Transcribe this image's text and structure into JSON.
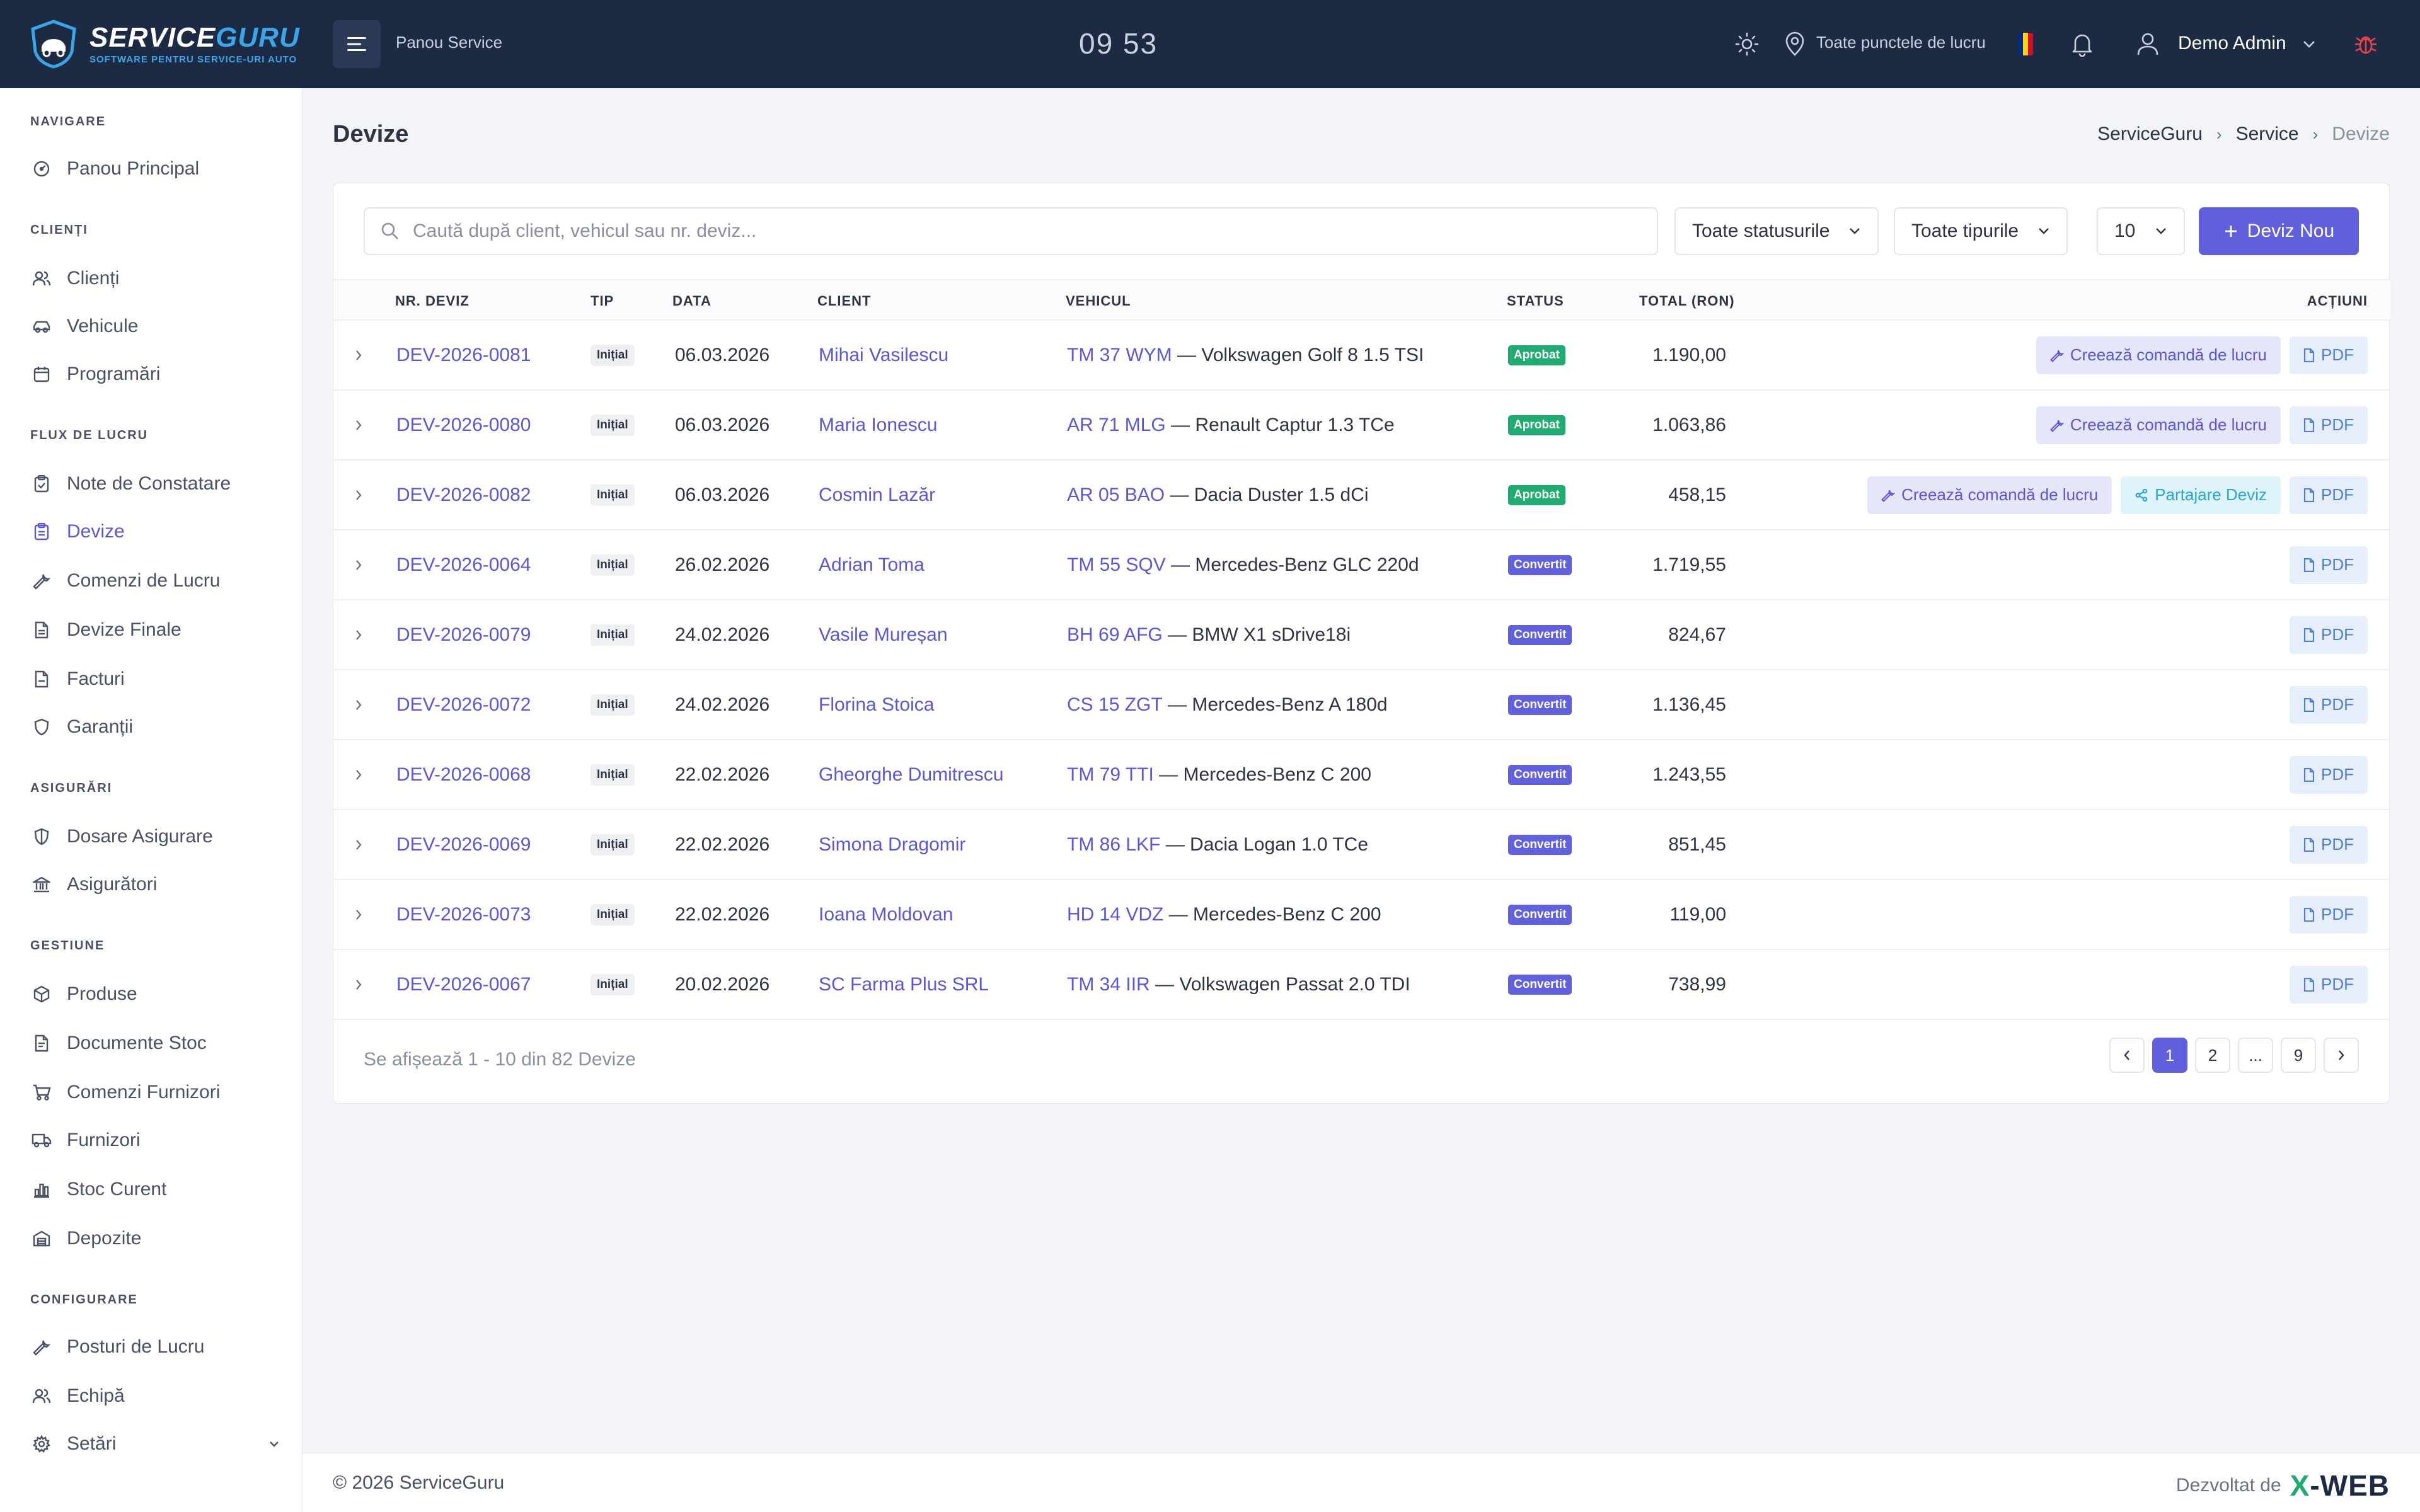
{
  "brand": {
    "title_main": "SERVICE",
    "title_accent": "GURU",
    "subtitle": "SOFTWARE PENTRU SERVICE-URI AUTO"
  },
  "header": {
    "panel_label": "Panou Service",
    "clock": "09 53",
    "location": "Toate punctele de lucru",
    "user": "Demo Admin",
    "flag_colors": [
      "#002b7f",
      "#fcd116",
      "#ce1126"
    ]
  },
  "sidebar": {
    "sections": [
      {
        "title": "NAVIGARE",
        "items": [
          {
            "label": "Panou Principal",
            "icon": "dashboard-icon"
          }
        ]
      },
      {
        "title": "CLIENȚI",
        "items": [
          {
            "label": "Clienți",
            "icon": "users-icon"
          },
          {
            "label": "Vehicule",
            "icon": "car-icon"
          },
          {
            "label": "Programări",
            "icon": "calendar-icon"
          }
        ]
      },
      {
        "title": "FLUX DE LUCRU",
        "items": [
          {
            "label": "Note de Constatare",
            "icon": "clipboard-icon"
          },
          {
            "label": "Devize",
            "icon": "clipboard-list-icon",
            "active": true
          },
          {
            "label": "Comenzi de Lucru",
            "icon": "wrench-icon"
          },
          {
            "label": "Devize Finale",
            "icon": "document-icon"
          },
          {
            "label": "Facturi",
            "icon": "invoice-icon"
          },
          {
            "label": "Garanții",
            "icon": "shield-icon"
          }
        ]
      },
      {
        "title": "ASIGURĂRI",
        "items": [
          {
            "label": "Dosare Asigurare",
            "icon": "shield-half-icon"
          },
          {
            "label": "Asigurători",
            "icon": "bank-icon"
          }
        ]
      },
      {
        "title": "GESTIUNE",
        "items": [
          {
            "label": "Produse",
            "icon": "box-icon"
          },
          {
            "label": "Documente Stoc",
            "icon": "file-text-icon"
          },
          {
            "label": "Comenzi Furnizori",
            "icon": "cart-icon"
          },
          {
            "label": "Furnizori",
            "icon": "truck-icon"
          },
          {
            "label": "Stoc Curent",
            "icon": "bar-chart-icon"
          },
          {
            "label": "Depozite",
            "icon": "warehouse-icon"
          }
        ]
      },
      {
        "title": "CONFIGURARE",
        "items": [
          {
            "label": "Posturi de Lucru",
            "icon": "tools-icon"
          },
          {
            "label": "Echipă",
            "icon": "user-group-icon"
          },
          {
            "label": "Setări",
            "icon": "gear-icon",
            "has_chevron": true
          }
        ]
      }
    ]
  },
  "page": {
    "title": "Devize",
    "breadcrumb": [
      "ServiceGuru",
      "Service",
      "Devize"
    ]
  },
  "toolbar": {
    "search_placeholder": "Caută după client, vehicul sau nr. deviz...",
    "status_filter": "Toate statusurile",
    "type_filter": "Toate tipurile",
    "per_page": "10",
    "new_button": "Deviz Nou"
  },
  "table": {
    "columns": {
      "nr": "NR. DEVIZ",
      "tip": "TIP",
      "data": "DATA",
      "client": "CLIENT",
      "vehicul": "VEHICUL",
      "status": "STATUS",
      "total": "TOTAL (RON)",
      "actiuni": "ACȚIUNI"
    },
    "action_labels": {
      "create_order": "Creează comandă de lucru",
      "share": "Partajare Deviz",
      "pdf": "PDF"
    },
    "rows": [
      {
        "nr": "DEV-2026-0081",
        "tip": "Inițial",
        "data": "06.03.2026",
        "client": "Mihai Vasilescu",
        "plate": "TM 37 WYM",
        "model": " — Volkswagen Golf 8 1.5 TSI",
        "status": "Aprobat",
        "total": "1.190,00",
        "order": true,
        "share": false
      },
      {
        "nr": "DEV-2026-0080",
        "tip": "Inițial",
        "data": "06.03.2026",
        "client": "Maria Ionescu",
        "plate": "AR 71 MLG",
        "model": " — Renault Captur 1.3 TCe",
        "status": "Aprobat",
        "total": "1.063,86",
        "order": true,
        "share": false
      },
      {
        "nr": "DEV-2026-0082",
        "tip": "Inițial",
        "data": "06.03.2026",
        "client": "Cosmin Lazăr",
        "plate": "AR 05 BAO",
        "model": " — Dacia Duster 1.5 dCi",
        "status": "Aprobat",
        "total": "458,15",
        "order": true,
        "share": true
      },
      {
        "nr": "DEV-2026-0064",
        "tip": "Inițial",
        "data": "26.02.2026",
        "client": "Adrian Toma",
        "plate": "TM 55 SQV",
        "model": " — Mercedes-Benz GLC 220d",
        "status": "Convertit",
        "total": "1.719,55",
        "order": false,
        "share": false
      },
      {
        "nr": "DEV-2026-0079",
        "tip": "Inițial",
        "data": "24.02.2026",
        "client": "Vasile Mureșan",
        "plate": "BH 69 AFG",
        "model": " — BMW X1 sDrive18i",
        "status": "Convertit",
        "total": "824,67",
        "order": false,
        "share": false
      },
      {
        "nr": "DEV-2026-0072",
        "tip": "Inițial",
        "data": "24.02.2026",
        "client": "Florina Stoica",
        "plate": "CS 15 ZGT",
        "model": " — Mercedes-Benz A 180d",
        "status": "Convertit",
        "total": "1.136,45",
        "order": false,
        "share": false
      },
      {
        "nr": "DEV-2026-0068",
        "tip": "Inițial",
        "data": "22.02.2026",
        "client": "Gheorghe Dumitrescu",
        "plate": "TM 79 TTI",
        "model": " — Mercedes-Benz C 200",
        "status": "Convertit",
        "total": "1.243,55",
        "order": false,
        "share": false
      },
      {
        "nr": "DEV-2026-0069",
        "tip": "Inițial",
        "data": "22.02.2026",
        "client": "Simona Dragomir",
        "plate": "TM 86 LKF",
        "model": " — Dacia Logan 1.0 TCe",
        "status": "Convertit",
        "total": "851,45",
        "order": false,
        "share": false
      },
      {
        "nr": "DEV-2026-0073",
        "tip": "Inițial",
        "data": "22.02.2026",
        "client": "Ioana Moldovan",
        "plate": "HD 14 VDZ",
        "model": " — Mercedes-Benz C 200",
        "status": "Convertit",
        "total": "119,00",
        "order": false,
        "share": false
      },
      {
        "nr": "DEV-2026-0067",
        "tip": "Inițial",
        "data": "20.02.2026",
        "client": "SC Farma Plus SRL",
        "plate": "TM 34 IIR",
        "model": " — Volkswagen Passat 2.0 TDI",
        "status": "Convertit",
        "total": "738,99",
        "order": false,
        "share": false
      }
    ]
  },
  "pagination": {
    "info": "Se afișează 1 - 10 din 82 Devize",
    "pages": [
      "1",
      "2",
      "...",
      "9"
    ],
    "active": "1"
  },
  "footer": {
    "copyright": "© 2026 ServiceGuru",
    "developed_by": "Dezvoltat de",
    "dev_logo_x": "X",
    "dev_logo_rest": "-WEB"
  },
  "colors": {
    "accent": "#6160dd",
    "header_bg": "#1d2a43",
    "approved": "#1fab72",
    "converted": "#6160dd"
  }
}
